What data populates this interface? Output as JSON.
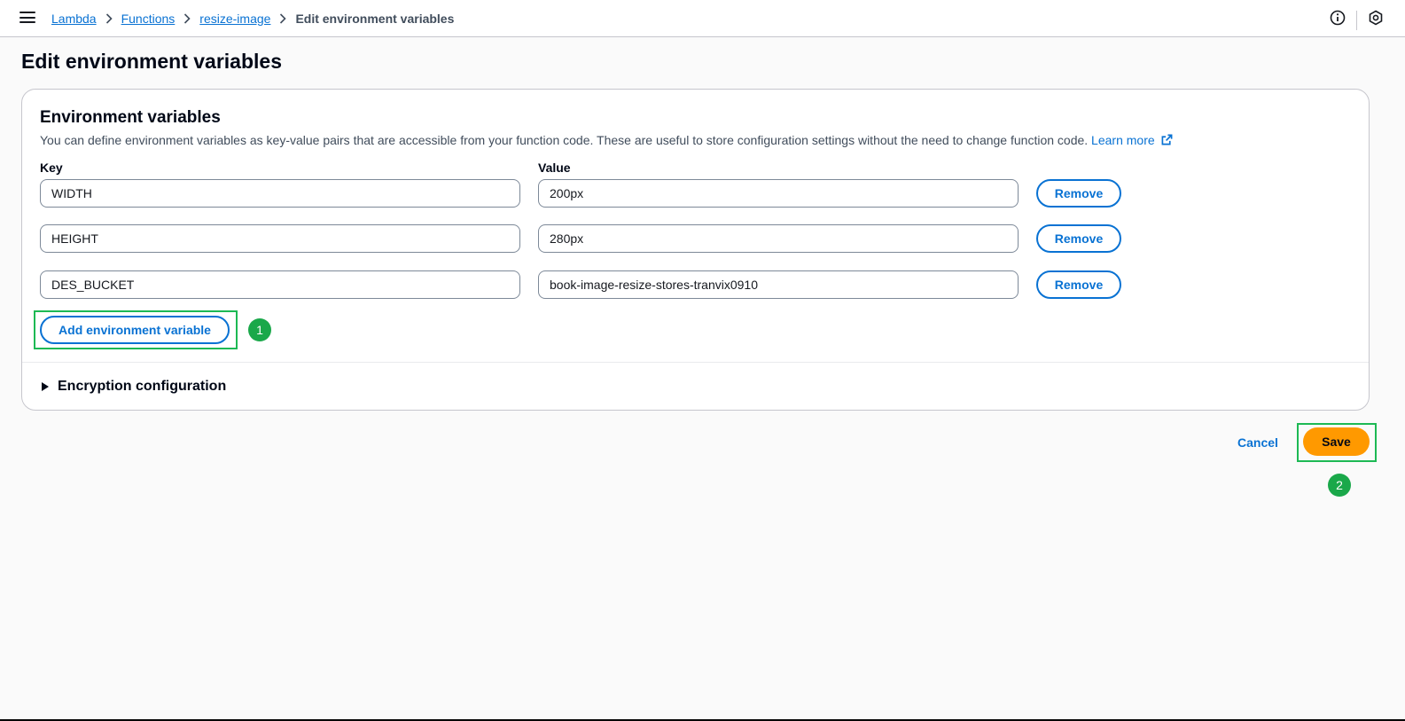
{
  "breadcrumb": {
    "items": [
      "Lambda",
      "Functions",
      "resize-image"
    ],
    "current": "Edit environment variables"
  },
  "page": {
    "title": "Edit environment variables"
  },
  "panel": {
    "title": "Environment variables",
    "description": "You can define environment variables as key-value pairs that are accessible from your function code. These are useful to store configuration settings without the need to change function code.",
    "learn_more": "Learn more",
    "key_label": "Key",
    "value_label": "Value",
    "rows": [
      {
        "key": "WIDTH",
        "value": "200px",
        "remove": "Remove"
      },
      {
        "key": "HEIGHT",
        "value": "280px",
        "remove": "Remove"
      },
      {
        "key": "DES_BUCKET",
        "value": "book-image-resize-stores-tranvix0910",
        "remove": "Remove"
      }
    ],
    "add_button": "Add environment variable",
    "encryption": "Encryption configuration"
  },
  "actions": {
    "cancel": "Cancel",
    "save": "Save"
  },
  "annotations": {
    "step1": "1",
    "step2": "2"
  },
  "colors": {
    "accent": "#0972d3",
    "primary": "#ff9900",
    "highlight": "#1db954"
  }
}
